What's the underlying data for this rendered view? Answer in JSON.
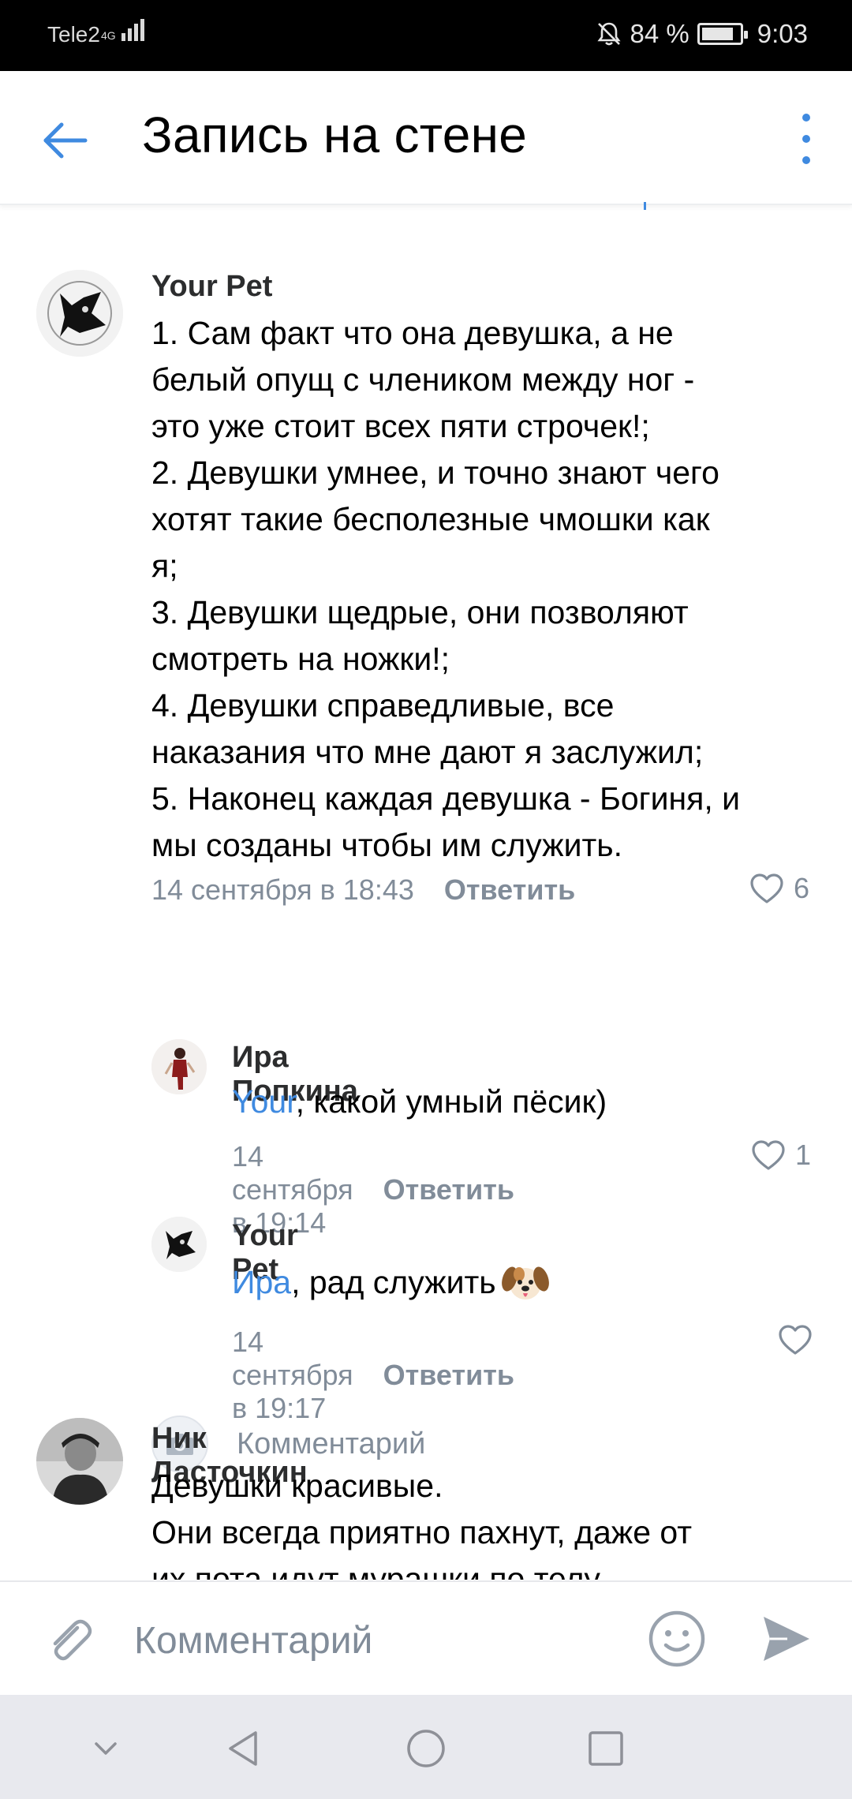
{
  "status_bar": {
    "carrier": "Tele2",
    "network": "4G",
    "battery": "84 %",
    "battery_level": 0.84,
    "time": "9:03"
  },
  "header": {
    "title": "Запись на стене",
    "back_icon": "arrow-left-icon",
    "more_icon": "more-vertical-icon"
  },
  "comments": [
    {
      "author": "Your Pet",
      "text": "1. Сам факт что она девушка, а не\nбелый опущ с члеником между ног -\nэто уже стоит всех пяти строчек!;\n2. Девушки умнее, и точно знают чего\nхотят такие бесполезные чмошки как\nя;\n3. Девушки щедрые, они позволяют\nсмотреть на ножки!;\n4. Девушки справедливые, все\nнаказания что мне дают я заслужил;\n5. Наконец каждая девушка - Богиня, и\nмы созданы чтобы им служить.",
      "date": "14 сентября в 18:43",
      "reply_label": "Ответить",
      "likes": "6"
    },
    {
      "author": "Ира Попкина",
      "mention": "Your",
      "text": ", какой умный пёсик)",
      "date": "14 сентября в 19:14",
      "reply_label": "Ответить",
      "likes": "1"
    },
    {
      "author": "Your Pet",
      "mention": "Ира",
      "text": ", рад служить",
      "emoji": "dog-face-emoji",
      "date": "14 сентября в 19:17",
      "reply_label": "Ответить",
      "likes": ""
    },
    {
      "author": "Ник Ласточкин",
      "text": "Девушки красивые.\nОни всегда приятно пахнут, даже от\nих пота идут мурашки по телу"
    }
  ],
  "thread_reply": {
    "placeholder": "Комментарий",
    "icon": "camera-icon"
  },
  "composer": {
    "placeholder": "Комментарий",
    "attach_icon": "paperclip-icon",
    "emoji_icon": "smile-icon",
    "send_icon": "send-icon"
  },
  "nav_bar": {
    "icons": [
      "chevron-down-icon",
      "back-triangle-icon",
      "home-circle-icon",
      "recents-square-icon"
    ]
  },
  "colors": {
    "accent": "#3f8ae0",
    "secondary_text": "#818c99",
    "status_bar": "#000000"
  }
}
